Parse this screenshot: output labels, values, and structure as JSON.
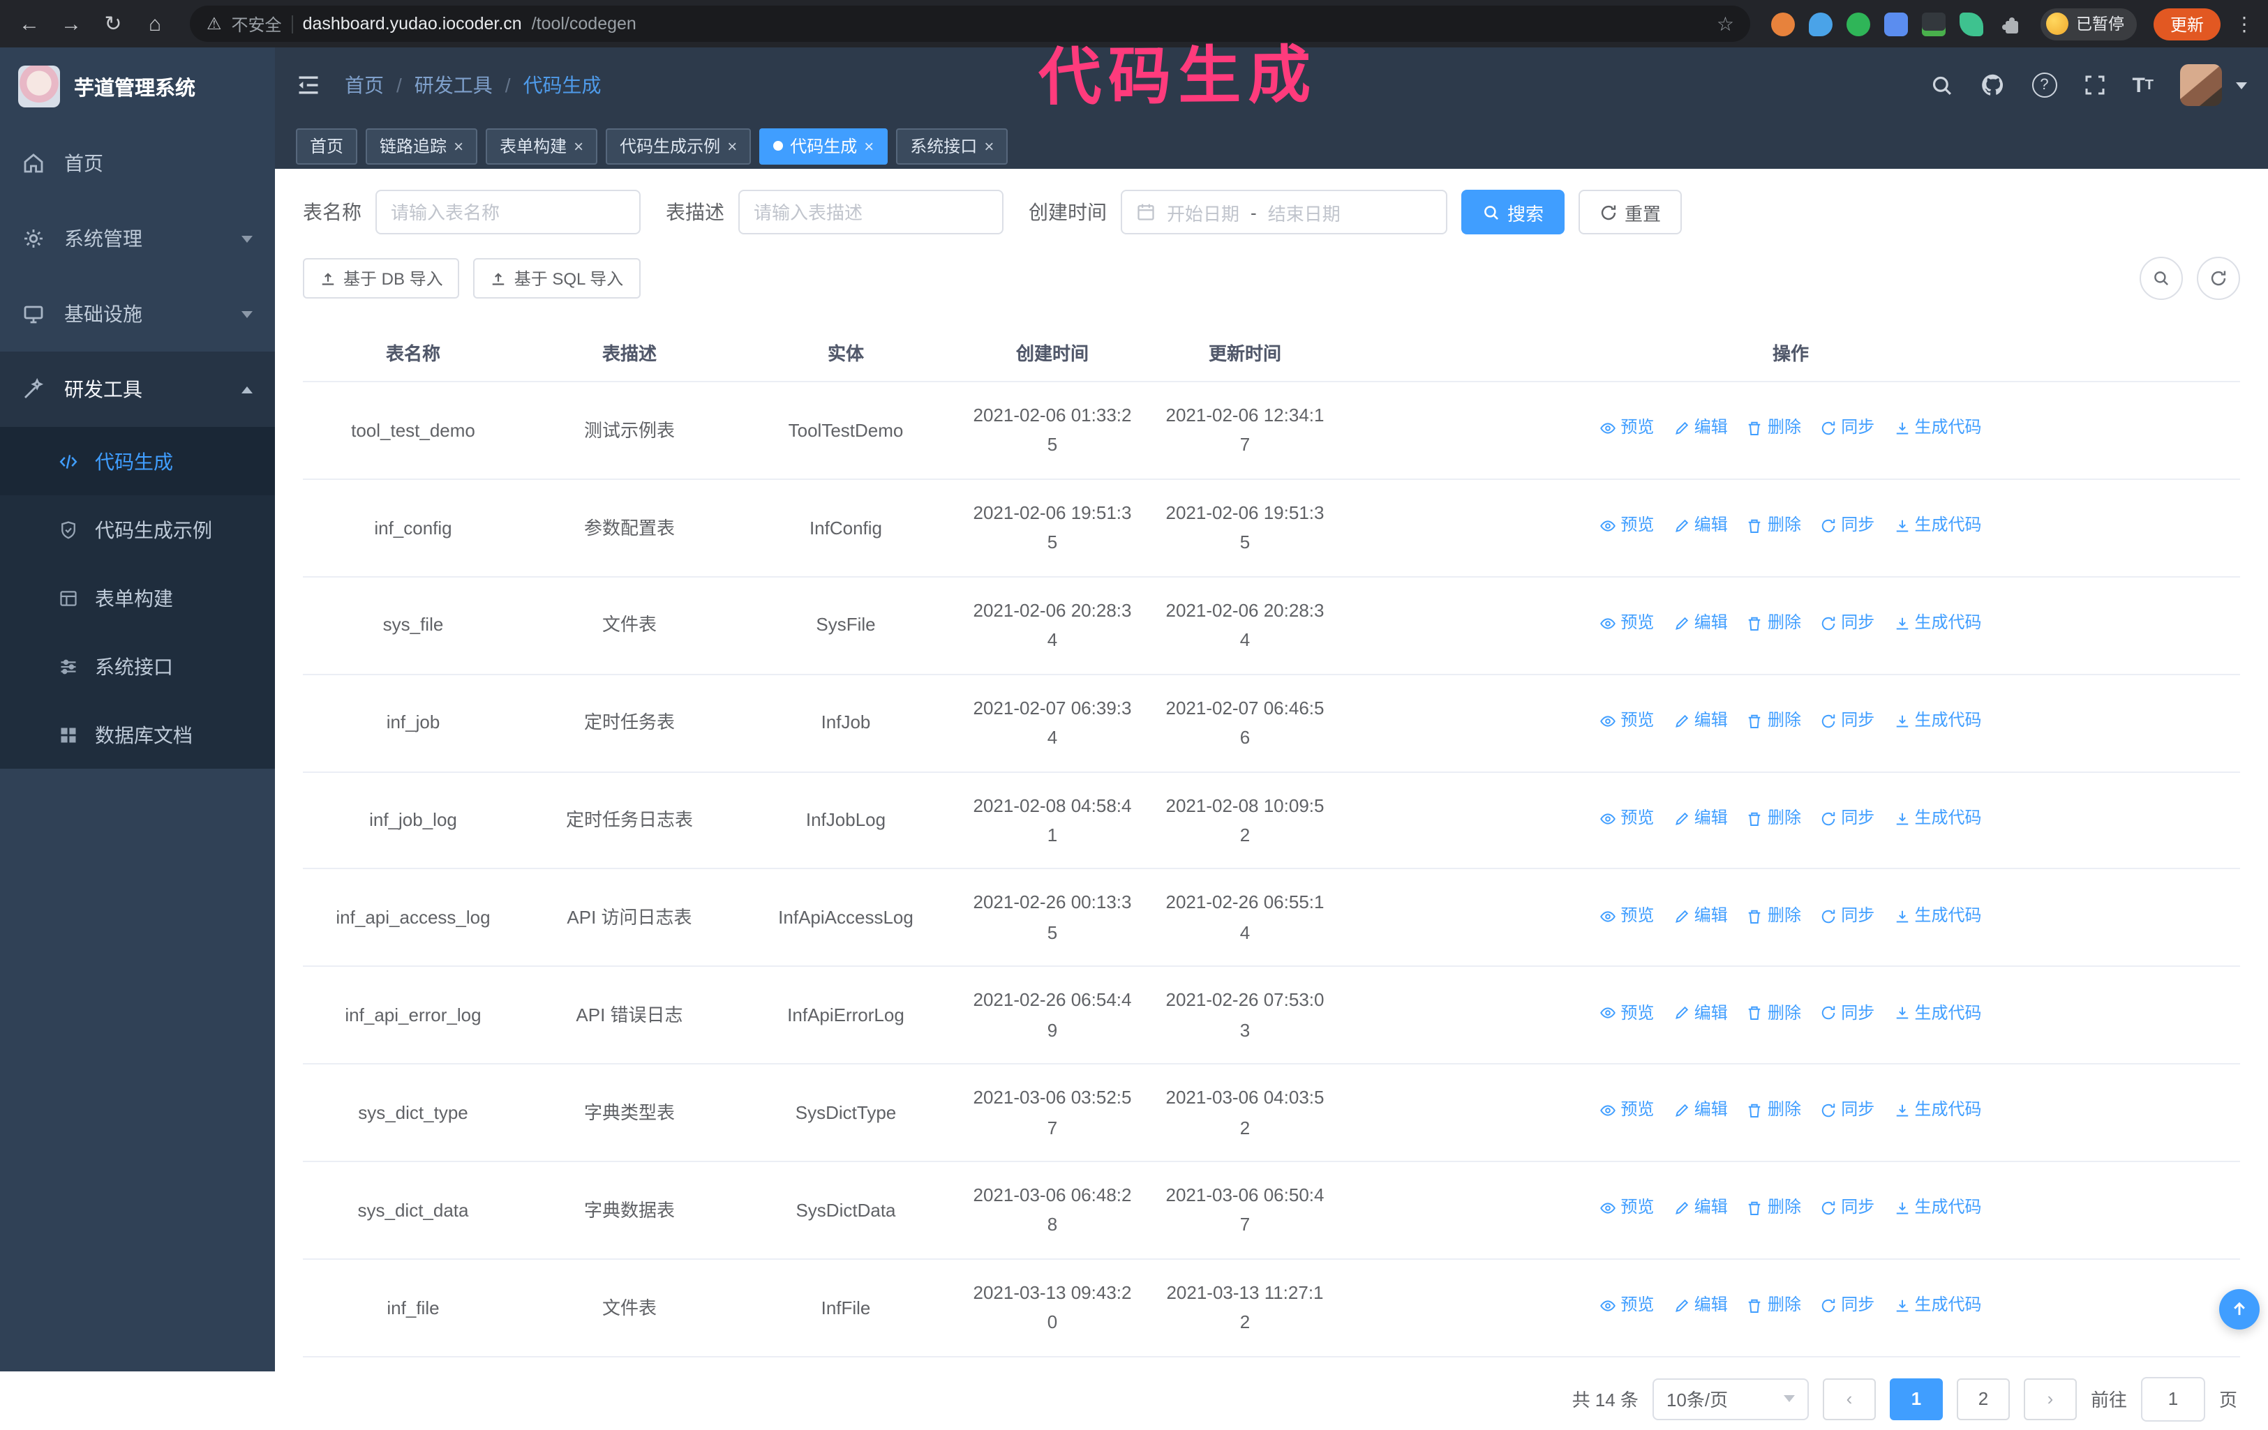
{
  "colors": {
    "accent": "#409eff",
    "annotation": "#ff3b7c",
    "update_button": "#e25822",
    "sidebar": "#304156",
    "header": "#2d3a4b"
  },
  "annotation": {
    "text": "代码生成"
  },
  "browser": {
    "security_label": "不安全",
    "url_host": "dashboard.yudao.iocoder.cn",
    "url_path": "/tool/codegen",
    "paused_badge": "已暂停",
    "update_button": "更新"
  },
  "icons": {
    "back": "←",
    "forward": "→",
    "reload": "↻",
    "home": "⌂",
    "warning": "⚠",
    "bookmark": "☆",
    "menu_dots": "⋮",
    "close": "×",
    "prev": "‹",
    "next": "›",
    "help": "?"
  },
  "sidebar": {
    "logo_title": "芋道管理系统",
    "items": [
      {
        "label": "首页"
      },
      {
        "label": "系统管理"
      },
      {
        "label": "基础设施"
      },
      {
        "label": "研发工具"
      }
    ],
    "submenu": [
      {
        "label": "代码生成",
        "active": true
      },
      {
        "label": "代码生成示例"
      },
      {
        "label": "表单构建"
      },
      {
        "label": "系统接口"
      },
      {
        "label": "数据库文档"
      }
    ]
  },
  "header": {
    "breadcrumb": [
      "首页",
      "研发工具",
      "代码生成"
    ]
  },
  "tags": [
    {
      "label": "首页",
      "closable": false
    },
    {
      "label": "链路追踪",
      "closable": true
    },
    {
      "label": "表单构建",
      "closable": true
    },
    {
      "label": "代码生成示例",
      "closable": true
    },
    {
      "label": "代码生成",
      "closable": true,
      "active": true
    },
    {
      "label": "系统接口",
      "closable": true
    }
  ],
  "filters": {
    "table_name_label": "表名称",
    "table_name_placeholder": "请输入表名称",
    "table_desc_label": "表描述",
    "table_desc_placeholder": "请输入表描述",
    "create_time_label": "创建时间",
    "date_start_placeholder": "开始日期",
    "date_separator": "-",
    "date_end_placeholder": "结束日期",
    "search_button": "搜索",
    "reset_button": "重置"
  },
  "toolbar": {
    "import_db": "基于 DB 导入",
    "import_sql": "基于 SQL 导入"
  },
  "table": {
    "columns": [
      "表名称",
      "表描述",
      "实体",
      "创建时间",
      "更新时间",
      "操作"
    ],
    "actions": [
      "预览",
      "编辑",
      "删除",
      "同步",
      "生成代码"
    ],
    "rows": [
      {
        "name": "tool_test_demo",
        "desc": "测试示例表",
        "entity": "ToolTestDemo",
        "created": "2021-02-06 01:33:25",
        "updated": "2021-02-06 12:34:17"
      },
      {
        "name": "inf_config",
        "desc": "参数配置表",
        "entity": "InfConfig",
        "created": "2021-02-06 19:51:35",
        "updated": "2021-02-06 19:51:35"
      },
      {
        "name": "sys_file",
        "desc": "文件表",
        "entity": "SysFile",
        "created": "2021-02-06 20:28:34",
        "updated": "2021-02-06 20:28:34"
      },
      {
        "name": "inf_job",
        "desc": "定时任务表",
        "entity": "InfJob",
        "created": "2021-02-07 06:39:34",
        "updated": "2021-02-07 06:46:56"
      },
      {
        "name": "inf_job_log",
        "desc": "定时任务日志表",
        "entity": "InfJobLog",
        "created": "2021-02-08 04:58:41",
        "updated": "2021-02-08 10:09:52"
      },
      {
        "name": "inf_api_access_log",
        "desc": "API 访问日志表",
        "entity": "InfApiAccessLog",
        "created": "2021-02-26 00:13:35",
        "updated": "2021-02-26 06:55:14"
      },
      {
        "name": "inf_api_error_log",
        "desc": "API 错误日志",
        "entity": "InfApiErrorLog",
        "created": "2021-02-26 06:54:49",
        "updated": "2021-02-26 07:53:03"
      },
      {
        "name": "sys_dict_type",
        "desc": "字典类型表",
        "entity": "SysDictType",
        "created": "2021-03-06 03:52:57",
        "updated": "2021-03-06 04:03:52"
      },
      {
        "name": "sys_dict_data",
        "desc": "字典数据表",
        "entity": "SysDictData",
        "created": "2021-03-06 06:48:28",
        "updated": "2021-03-06 06:50:47"
      },
      {
        "name": "inf_file",
        "desc": "文件表",
        "entity": "InfFile",
        "created": "2021-03-13 09:43:20",
        "updated": "2021-03-13 11:27:12"
      }
    ]
  },
  "pagination": {
    "total": "共 14 条",
    "page_size": "10条/页",
    "pages": [
      "1",
      "2"
    ],
    "active_page": "1",
    "goto_label": "前往",
    "goto_value": "1",
    "goto_suffix": "页"
  }
}
